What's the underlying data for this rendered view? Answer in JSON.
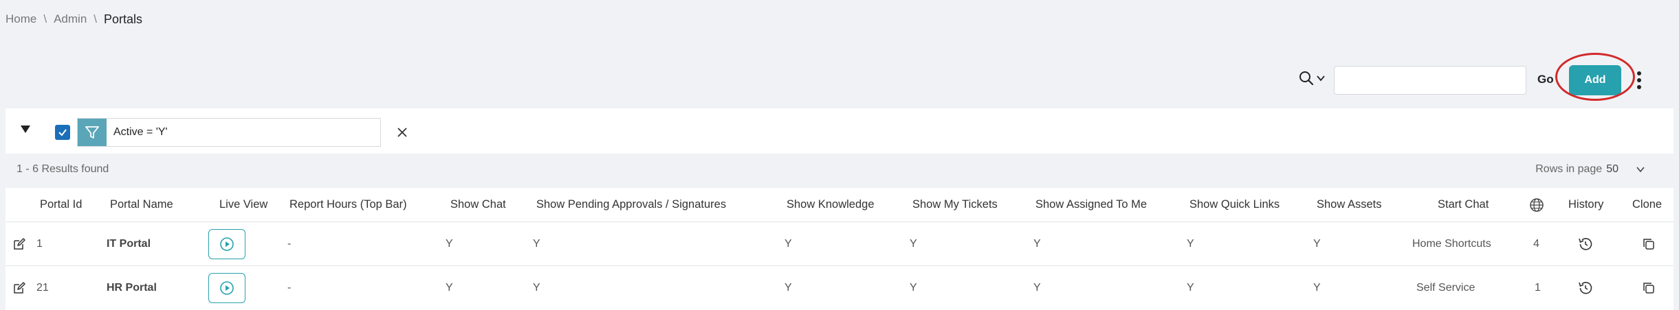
{
  "breadcrumb": {
    "home": "Home",
    "admin": "Admin",
    "current": "Portals",
    "separator": "\\"
  },
  "toolbar": {
    "go_label": "Go",
    "add_label": "Add",
    "search_value": ""
  },
  "filter": {
    "text": "Active = 'Y'",
    "checked": true
  },
  "results": {
    "summary": "1 - 6 Results found",
    "rows_label": "Rows in page",
    "rows_value": "50"
  },
  "table": {
    "columns": [
      "Portal Id",
      "Portal Name",
      "Live View",
      "Report Hours (Top Bar)",
      "Show Chat",
      "Show Pending Approvals / Signatures",
      "Show Knowledge",
      "Show My Tickets",
      "Show Assigned To Me",
      "Show Quick Links",
      "Show Assets",
      "Start Chat",
      "language-icon",
      "History",
      "Clone"
    ],
    "rows": [
      {
        "id": "1",
        "name": "IT Portal",
        "report_hours": "-",
        "show_chat": "Y",
        "show_pending": "Y",
        "show_knowledge": "Y",
        "show_my_tickets": "Y",
        "show_assigned": "Y",
        "show_quick_links": "Y",
        "show_assets": "Y",
        "start_chat": "Home Shortcuts",
        "languages": "4"
      },
      {
        "id": "21",
        "name": "HR Portal",
        "report_hours": "-",
        "show_chat": "Y",
        "show_pending": "Y",
        "show_knowledge": "Y",
        "show_my_tickets": "Y",
        "show_assigned": "Y",
        "show_quick_links": "Y",
        "show_assets": "Y",
        "start_chat": "Self Service",
        "languages": "1"
      }
    ]
  },
  "colors": {
    "accent": "#27a1ad",
    "highlight_circle": "#d12a2a",
    "checkbox": "#1a6fb8",
    "filter_funnel_bg": "#5aa6b8",
    "page_bg": "#f1f2f6"
  }
}
